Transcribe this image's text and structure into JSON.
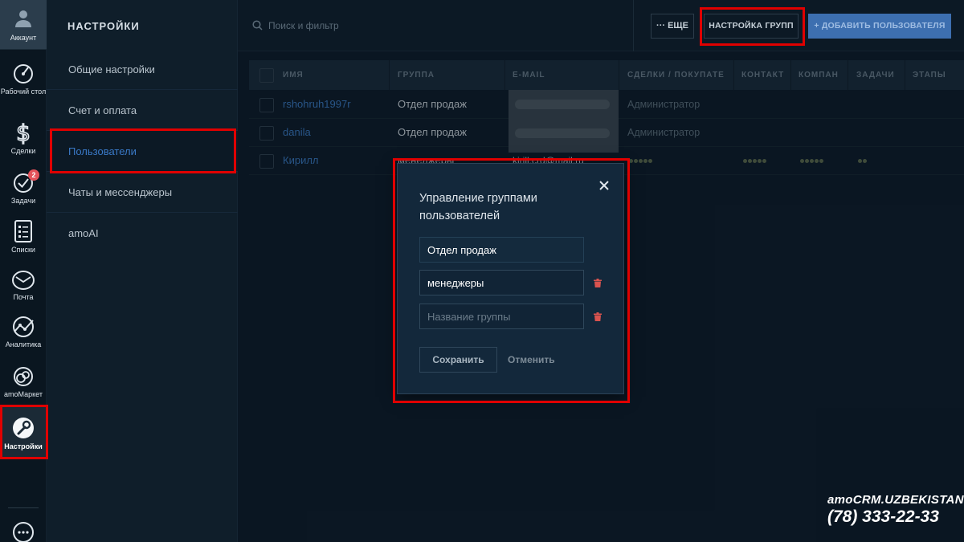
{
  "rail": {
    "account_label": "Аккаунт",
    "items": [
      {
        "label": "Рабочий стол",
        "icon": "dashboard-icon"
      },
      {
        "label": "Сделки",
        "icon": "dollar-icon"
      },
      {
        "label": "Задачи",
        "icon": "tasks-icon",
        "badge": "2"
      },
      {
        "label": "Списки",
        "icon": "lists-icon"
      },
      {
        "label": "Почта",
        "icon": "mail-icon"
      },
      {
        "label": "Аналитика",
        "icon": "analytics-icon"
      },
      {
        "label": "amoМаркет",
        "icon": "market-icon"
      },
      {
        "label": "Настройки",
        "icon": "settings-icon",
        "active": true
      }
    ],
    "chat_icon": "chat-icon"
  },
  "settings_nav": {
    "title": "НАСТРОЙКИ",
    "items": [
      {
        "label": "Общие настройки"
      },
      {
        "label": "Счет и оплата"
      },
      {
        "label": "Пользователи",
        "active": true
      },
      {
        "label": "Чаты и мессенджеры"
      },
      {
        "label": "amoAI"
      }
    ]
  },
  "topbar": {
    "search_placeholder": "Поиск и фильтр",
    "more_label": "··· ЕЩЕ",
    "groups_label": "НАСТРОЙКА ГРУПП",
    "add_user_label": "+ ДОБАВИТЬ ПОЛЬЗОВАТЕЛЯ"
  },
  "table": {
    "columns": [
      "ИМЯ",
      "ГРУППА",
      "E-MAIL",
      "СДЕЛКИ / ПОКУПАТЕ",
      "КОНТАКТ",
      "КОМПАН",
      "ЗАДАЧИ",
      "ЭТАПЫ"
    ],
    "rows": [
      {
        "name": "rshohruh1997r",
        "group": "Отдел продаж",
        "email": "",
        "deals": "Администратор",
        "contacts": "",
        "companies": "",
        "tasks": "",
        "stages": ""
      },
      {
        "name": "danila",
        "group": "Отдел продаж",
        "email": "",
        "deals": "Администратор",
        "contacts": "",
        "companies": "",
        "tasks": "",
        "stages": ""
      },
      {
        "name": "Кирилл",
        "group": "менеджеры",
        "email": "kirill.crd@mail.ru",
        "deals": "",
        "contacts": "",
        "companies": "",
        "tasks": "",
        "stages": ""
      }
    ]
  },
  "modal": {
    "title": "Управление группами пользователей",
    "groups": [
      "Отдел продаж",
      "менеджеры"
    ],
    "new_group_placeholder": "Название группы",
    "save_label": "Сохранить",
    "cancel_label": "Отменить"
  },
  "brand": {
    "name": "amoCRM.UZBEKISTAN",
    "phone": "(78) 333-22-33"
  },
  "colors": {
    "accent": "#3d6fb0",
    "link": "#3a7ac3",
    "highlight": "#e00000",
    "badge": "#e4525a"
  }
}
